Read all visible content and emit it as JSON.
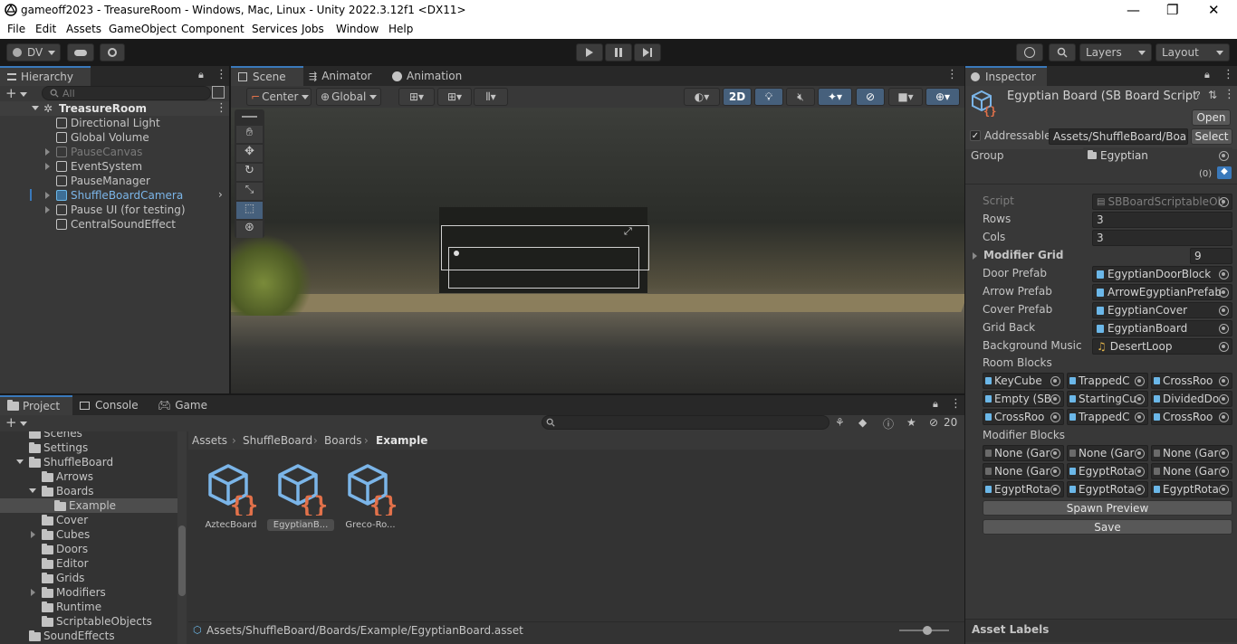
{
  "window": {
    "title": "gameoff2023 - TreasureRoom - Windows, Mac, Linux - Unity 2022.3.12f1 <DX11>",
    "controls": [
      "—",
      "❐",
      "✕"
    ]
  },
  "menu": [
    "File",
    "Edit",
    "Assets",
    "GameObject",
    "Component",
    "Services",
    "Jobs",
    "Window",
    "Help"
  ],
  "toolbar": {
    "account": "DV",
    "layers": "Layers",
    "layout": "Layout"
  },
  "hierarchy": {
    "tab": "Hierarchy",
    "search_placeholder": "All",
    "scene": "TreasureRoom",
    "items": [
      {
        "label": "Directional Light",
        "has_children": false,
        "state": "normal"
      },
      {
        "label": "Global Volume",
        "has_children": false,
        "state": "normal"
      },
      {
        "label": "PauseCanvas",
        "has_children": true,
        "state": "disabled"
      },
      {
        "label": "EventSystem",
        "has_children": true,
        "state": "normal"
      },
      {
        "label": "PauseManager",
        "has_children": false,
        "state": "normal"
      },
      {
        "label": "ShuffleBoardCamera",
        "has_children": true,
        "state": "prefab"
      },
      {
        "label": "Pause UI  (for testing)",
        "has_children": true,
        "state": "normal"
      },
      {
        "label": "CentralSoundEffect",
        "has_children": false,
        "state": "normal"
      }
    ]
  },
  "scene_view": {
    "tabs": [
      "Scene",
      "Animator",
      "Animation"
    ],
    "pivot": "Center",
    "space": "Global",
    "mode_2d": "2D"
  },
  "project": {
    "tabs": [
      "Project",
      "Console",
      "Game"
    ],
    "hidden_count": "20",
    "tree": [
      {
        "label": "Scenes",
        "depth": 1,
        "expand": "none",
        "selected": false
      },
      {
        "label": "Settings",
        "depth": 1,
        "expand": "none",
        "selected": false
      },
      {
        "label": "ShuffleBoard",
        "depth": 1,
        "expand": "open",
        "selected": false
      },
      {
        "label": "Arrows",
        "depth": 2,
        "expand": "none",
        "selected": false
      },
      {
        "label": "Boards",
        "depth": 2,
        "expand": "open",
        "selected": false
      },
      {
        "label": "Example",
        "depth": 3,
        "expand": "none",
        "selected": true
      },
      {
        "label": "Cover",
        "depth": 2,
        "expand": "none",
        "selected": false
      },
      {
        "label": "Cubes",
        "depth": 2,
        "expand": "closed",
        "selected": false
      },
      {
        "label": "Doors",
        "depth": 2,
        "expand": "none",
        "selected": false
      },
      {
        "label": "Editor",
        "depth": 2,
        "expand": "none",
        "selected": false
      },
      {
        "label": "Grids",
        "depth": 2,
        "expand": "none",
        "selected": false
      },
      {
        "label": "Modifiers",
        "depth": 2,
        "expand": "closed",
        "selected": false
      },
      {
        "label": "Runtime",
        "depth": 2,
        "expand": "none",
        "selected": false
      },
      {
        "label": "ScriptableObjects",
        "depth": 2,
        "expand": "none",
        "selected": false
      },
      {
        "label": "SoundEffects",
        "depth": 1,
        "expand": "none",
        "selected": false
      }
    ],
    "breadcrumb": [
      "Assets",
      "ShuffleBoard",
      "Boards",
      "Example"
    ],
    "assets": [
      {
        "label": "AztecBoard",
        "selected": false
      },
      {
        "label": "EgyptianB...",
        "selected": true
      },
      {
        "label": "Greco-Ro...",
        "selected": false
      }
    ],
    "status_path": "Assets/ShuffleBoard/Boards/Example/EgyptianBoard.asset"
  },
  "inspector": {
    "tab": "Inspector",
    "title": "Egyptian Board (SB Board Script",
    "open_button": "Open",
    "addressable_label": "Addressable",
    "addressable_checked": true,
    "addressable_path": "Assets/ShuffleBoard/Boar",
    "select_button": "Select",
    "group_label": "Group",
    "group_value": "Egyptian",
    "labels_count": "(0)",
    "fields": [
      {
        "label": "Script",
        "value": "SBBoardScriptableOb",
        "kind": "script"
      },
      {
        "label": "Rows",
        "value": "3",
        "kind": "int"
      },
      {
        "label": "Cols",
        "value": "3",
        "kind": "int"
      },
      {
        "label": "Modifier Grid",
        "value": "9",
        "kind": "foldout"
      },
      {
        "label": "Door Prefab",
        "value": "EgyptianDoorBlock",
        "kind": "prefab"
      },
      {
        "label": "Arrow Prefab",
        "value": "ArrowEgyptianPrefab",
        "kind": "prefab"
      },
      {
        "label": "Cover Prefab",
        "value": "EgyptianCover",
        "kind": "prefab"
      },
      {
        "label": "Grid Back",
        "value": "EgyptianBoard",
        "kind": "prefab"
      },
      {
        "label": "Background Music",
        "value": "DesertLoop",
        "kind": "audio"
      }
    ],
    "room_blocks_label": "Room Blocks",
    "room_blocks": [
      "KeyCube",
      "TrappedC",
      "CrossRoo",
      "Empty (SB",
      "StartingCu",
      "DividedDo",
      "CrossRoo",
      "TrappedC",
      "CrossRoo"
    ],
    "modifier_blocks_label": "Modifier Blocks",
    "modifier_blocks": [
      "None (Gar",
      "None (Gar",
      "None (Gar",
      "None (Gar",
      "EgyptRota",
      "None (Gar",
      "EgyptRota",
      "EgyptRota",
      "EgyptRota"
    ],
    "spawn_button": "Spawn Preview",
    "save_button": "Save",
    "asset_labels": "Asset Labels"
  },
  "colors": {
    "accent": "#3a79bb",
    "prefab_blue": "#7bb5e8",
    "script_orange": "#e2714a"
  }
}
